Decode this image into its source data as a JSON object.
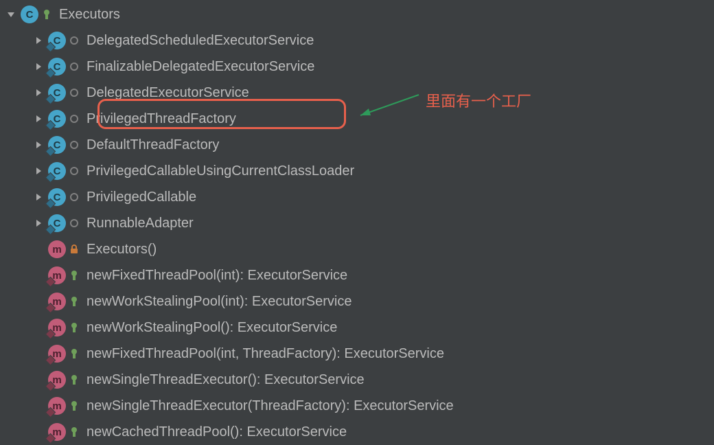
{
  "root": {
    "label": "Executors"
  },
  "classes": [
    {
      "label": "DelegatedScheduledExecutorService"
    },
    {
      "label": "FinalizableDelegatedExecutorService"
    },
    {
      "label": "DelegatedExecutorService"
    },
    {
      "label": "PrivilegedThreadFactory"
    },
    {
      "label": "DefaultThreadFactory"
    },
    {
      "label": "PrivilegedCallableUsingCurrentClassLoader"
    },
    {
      "label": "PrivilegedCallable"
    },
    {
      "label": "RunnableAdapter"
    }
  ],
  "ctor": {
    "label": "Executors()"
  },
  "methods": [
    {
      "label": "newFixedThreadPool(int): ExecutorService"
    },
    {
      "label": "newWorkStealingPool(int): ExecutorService"
    },
    {
      "label": "newWorkStealingPool(): ExecutorService"
    },
    {
      "label": "newFixedThreadPool(int, ThreadFactory): ExecutorService"
    },
    {
      "label": "newSingleThreadExecutor(): ExecutorService"
    },
    {
      "label": "newSingleThreadExecutor(ThreadFactory): ExecutorService"
    },
    {
      "label": "newCachedThreadPool(): ExecutorService"
    }
  ],
  "annotation": {
    "text": "里面有一个工厂"
  }
}
